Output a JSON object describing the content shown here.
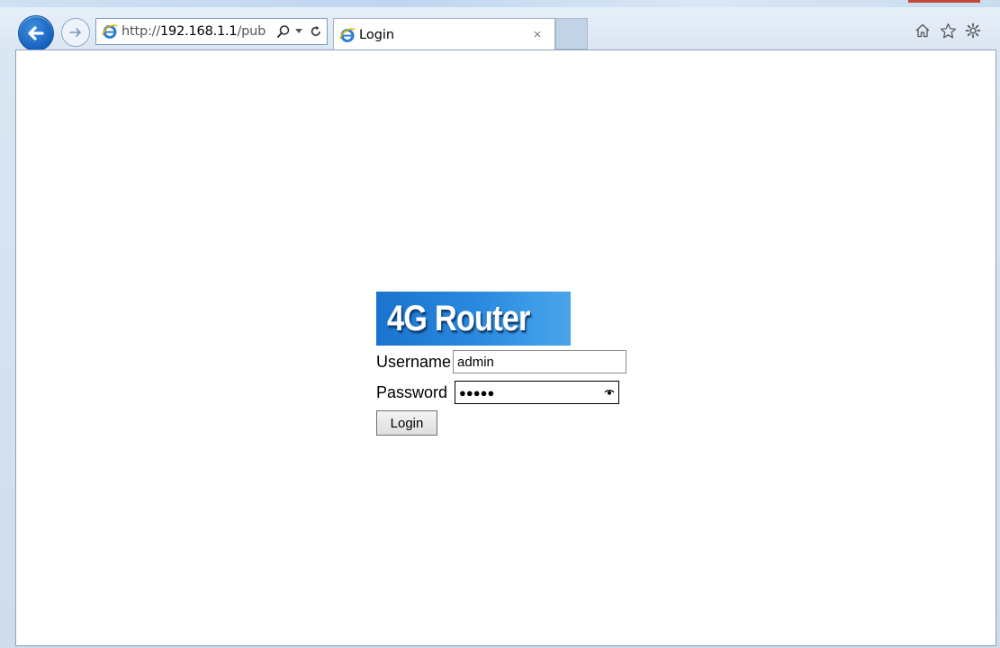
{
  "browser": {
    "address": {
      "url_prefix": "http://",
      "url_host": "192.168.1.1",
      "url_rest": "/pub"
    },
    "tab": {
      "title": "Login",
      "close_glyph": "×"
    },
    "icons": [
      "back-arrow-icon",
      "forward-arrow-icon",
      "ie-logo-icon",
      "search-icon",
      "dropdown-icon",
      "refresh-icon",
      "home-icon",
      "favorites-star-icon",
      "settings-gear-icon"
    ]
  },
  "login": {
    "logo_text": "4G Router",
    "username_label": "Username",
    "username_value": "admin",
    "password_label": "Password",
    "password_masked": "●●●●●",
    "login_button": "Login"
  },
  "colors": {
    "logo_bg": "#2b8be0",
    "back_button": "#1660bd",
    "chrome_bg": "#dbe6f3"
  }
}
